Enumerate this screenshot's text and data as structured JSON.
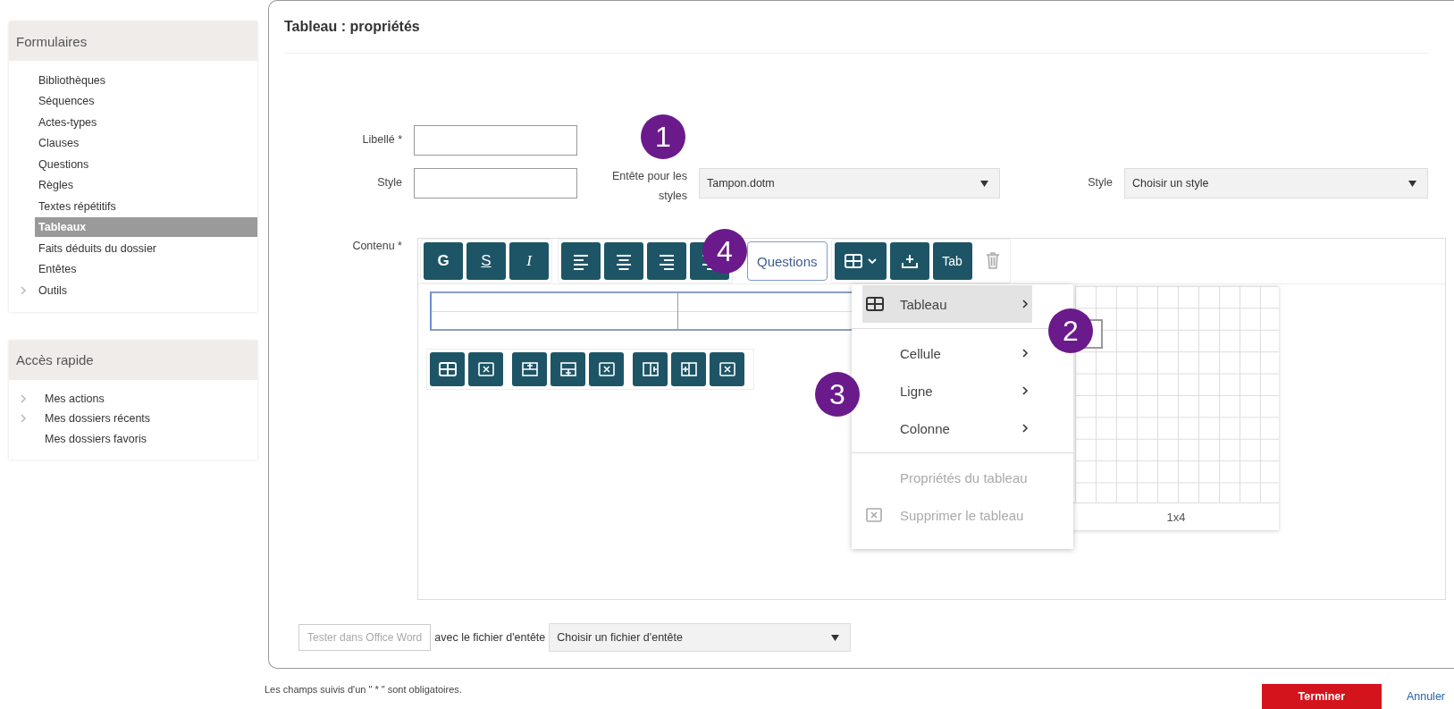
{
  "sidebar": {
    "sections": [
      {
        "title": "Formulaires",
        "items": [
          {
            "label": "Bibliothèques",
            "selected": false,
            "expandable": false
          },
          {
            "label": "Séquences",
            "selected": false,
            "expandable": false
          },
          {
            "label": "Actes-types",
            "selected": false,
            "expandable": false
          },
          {
            "label": "Clauses",
            "selected": false,
            "expandable": false
          },
          {
            "label": "Questions",
            "selected": false,
            "expandable": false
          },
          {
            "label": "Règles",
            "selected": false,
            "expandable": false
          },
          {
            "label": "Textes répétitifs",
            "selected": false,
            "expandable": false
          },
          {
            "label": "Tableaux",
            "selected": true,
            "expandable": false
          },
          {
            "label": "Faits déduits du dossier",
            "selected": false,
            "expandable": false
          },
          {
            "label": "Entêtes",
            "selected": false,
            "expandable": false
          },
          {
            "label": "Outils",
            "selected": false,
            "expandable": true
          }
        ]
      },
      {
        "title": "Accès rapide",
        "items": [
          {
            "label": "Mes actions",
            "selected": false,
            "expandable": true
          },
          {
            "label": "Mes dossiers récents",
            "selected": false,
            "expandable": true
          },
          {
            "label": "Mes dossiers favoris",
            "selected": false,
            "expandable": false
          }
        ]
      }
    ]
  },
  "page_title": "Tableau : propriétés",
  "form": {
    "label_field_label": "Libellé *",
    "style_field_label": "Style",
    "header_label": "Entête pour les styles",
    "header_select": "Tampon.dotm",
    "style_select_label": "Style",
    "style_select": "Choisir un style",
    "content_label": "Contenu *"
  },
  "toolbar": {
    "format_buttons": [
      "G",
      "S",
      "I"
    ],
    "questions_button": "Questions",
    "tab_button": "Tab"
  },
  "table_menu": {
    "items": [
      {
        "label": "Tableau",
        "selected": true,
        "disabled": false,
        "submenu": true
      },
      {
        "label": "Cellule",
        "selected": false,
        "disabled": false,
        "submenu": true
      },
      {
        "label": "Ligne",
        "selected": false,
        "disabled": false,
        "submenu": true
      },
      {
        "label": "Colonne",
        "selected": false,
        "disabled": false,
        "submenu": true
      },
      {
        "label": "Propriétés du tableau",
        "selected": false,
        "disabled": true,
        "submenu": false
      },
      {
        "label": "Supprimer le tableau",
        "selected": false,
        "disabled": true,
        "submenu": false
      }
    ],
    "grid_size_label": "1x4"
  },
  "test_row": {
    "button": "Tester dans Office Word",
    "button_disabled": true,
    "label": "avec le fichier d'entête",
    "select": "Choisir un fichier d'entête"
  },
  "footer": {
    "note": "Les champs suivis d'un \" * \" sont obligatoires.",
    "finish_button": "Terminer",
    "cancel_link": "Annuler"
  },
  "callouts": [
    "1",
    "2",
    "3",
    "4"
  ]
}
